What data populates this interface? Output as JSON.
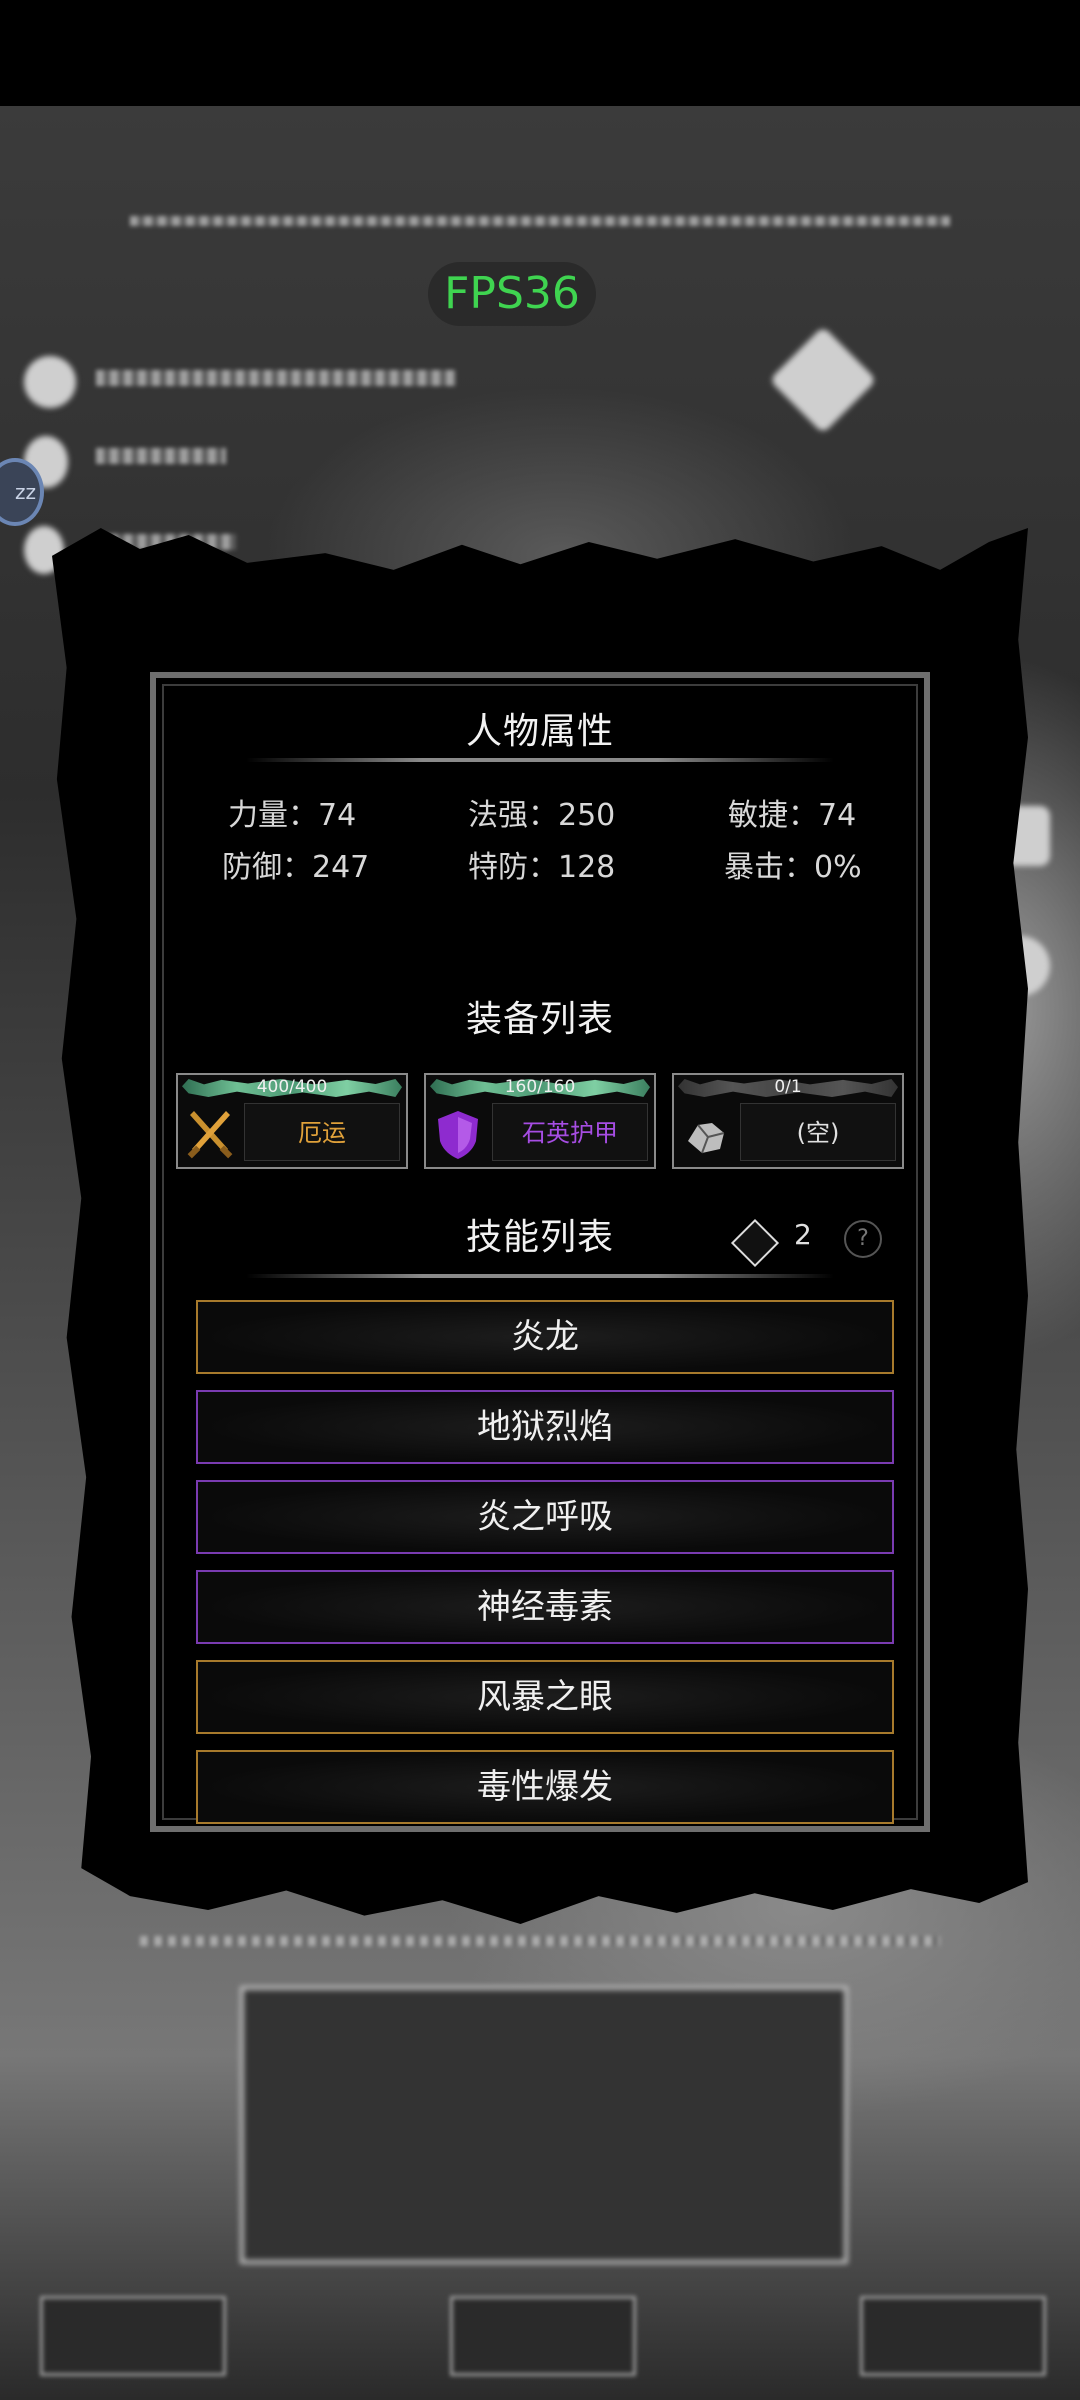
{
  "overlay": {
    "fps": "FPS36"
  },
  "panel": {
    "attributes_title": "人物属性",
    "stats": [
      {
        "label": "力量：74"
      },
      {
        "label": "法强：250"
      },
      {
        "label": "敏捷：74"
      },
      {
        "label": "防御：247"
      },
      {
        "label": "特防：128"
      },
      {
        "label": "暴击：0%"
      }
    ],
    "equipment_title": "装备列表",
    "equipment": [
      {
        "durability": "400/400",
        "durability_fraction": 1.0,
        "name": "厄运",
        "icon": "crossed-swords-icon",
        "name_color": "#e0a13a"
      },
      {
        "durability": "160/160",
        "durability_fraction": 1.0,
        "name": "石英护甲",
        "icon": "shield-icon",
        "name_color": "#a64de3"
      },
      {
        "durability": "0/1",
        "durability_fraction": 0.0,
        "name": "(空)",
        "icon": "accessory-icon",
        "name_color": "#e0e0e0"
      }
    ],
    "skills_title": "技能列表",
    "skill_points": "2",
    "help_glyph": "?",
    "skills": [
      {
        "name": "炎龙",
        "rarity": "gold"
      },
      {
        "name": "地狱烈焰",
        "rarity": "purple"
      },
      {
        "name": "炎之呼吸",
        "rarity": "purple"
      },
      {
        "name": "神经毒素",
        "rarity": "purple"
      },
      {
        "name": "风暴之眼",
        "rarity": "gold"
      },
      {
        "name": "毒性爆发",
        "rarity": "gold"
      }
    ]
  },
  "colors": {
    "gold_border": "#a77a2c",
    "purple_border": "#7a3bb1",
    "fps_green": "#3fd450"
  }
}
